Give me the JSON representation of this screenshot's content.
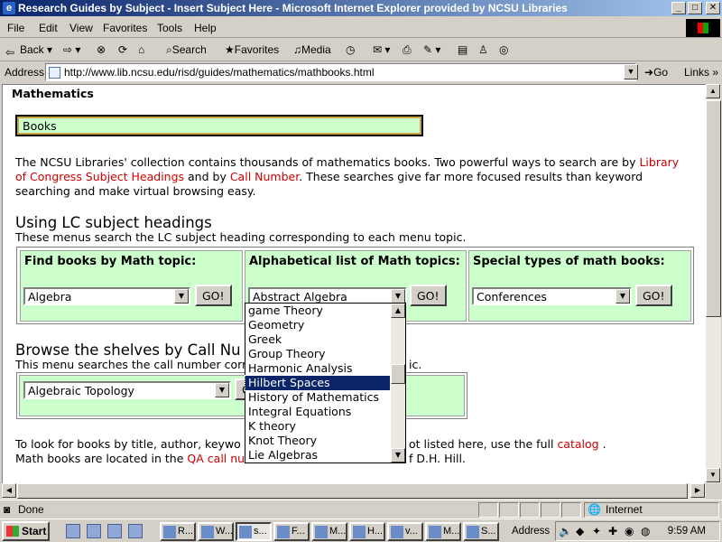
{
  "window": {
    "title": "Research Guides by Subject - Insert Subject Here - Microsoft Internet Explorer provided by NCSU Libraries",
    "min_label": "_",
    "max_label": "□",
    "close_label": "✕"
  },
  "menu": [
    "File",
    "Edit",
    "View",
    "Favorites",
    "Tools",
    "Help"
  ],
  "toolbar": {
    "back": "Back",
    "search": "Search",
    "favorites": "Favorites",
    "media": "Media"
  },
  "address": {
    "label": "Address",
    "url": "http://www.lib.ncsu.edu/risd/guides/mathematics/mathbooks.html",
    "go": "Go",
    "links": "Links"
  },
  "page": {
    "section_title": "Mathematics",
    "books_label": "Books",
    "intro": {
      "line1_a": "The NCSU Libraries' collection contains thousands of mathematics books. Two powerful ways to search are by ",
      "link_lc1": "Library",
      "link_lc2": "of Congress Subject Headings",
      "line2_mid": " and by ",
      "link_call": "Call Number",
      "line2_b": ". These searches give far more focused results than keyword",
      "line3": "searching and make virtual browsing easy."
    },
    "lc_heading": "Using LC subject headings",
    "lc_sub": "These menus search the LC subject heading corresponding to each menu topic.",
    "lc_cells": {
      "topic_label": "Find books by Math topic:",
      "topic_value": "Algebra",
      "alpha_label": "Alphabetical list of Math topics:",
      "alpha_value": "Abstract Algebra",
      "special_label": "Special types of math books:",
      "special_value": "Conferences",
      "go_label": "GO!"
    },
    "browse_heading": "Browse the shelves by Call Nu",
    "browse_sub_a": "This menu searches the call number corr",
    "browse_sub_b": "ic.",
    "browse_value": "Algebraic Topology",
    "browse_go": "G",
    "bottom1_a": "To look for books by title, author, keywo",
    "bottom1_b": "ot listed here, use the full ",
    "bottom1_link": "catalog",
    "bottom1_c": " .",
    "bottom2_a": "Math books are located in the ",
    "bottom2_qa": "QA",
    "bottom2_link": "call nu",
    "bottom2_b": "f D.H. Hill."
  },
  "dropdown": {
    "options": [
      "game Theory",
      "Geometry",
      "Greek",
      "Group Theory",
      "Harmonic Analysis",
      "Hilbert Spaces",
      "History of Mathematics",
      "Integral Equations",
      "K theory",
      "Knot Theory",
      "Lie Algebras"
    ],
    "selected": "Hilbert Spaces"
  },
  "status": {
    "text": "Done",
    "zone": "Internet"
  },
  "taskbar": {
    "start": "Start",
    "tasks": [
      "R...",
      "W...",
      "s...",
      "F...",
      "M...",
      "H...",
      "v...",
      "M...",
      "S..."
    ],
    "address": "Address",
    "clock": "9:59 AM"
  }
}
